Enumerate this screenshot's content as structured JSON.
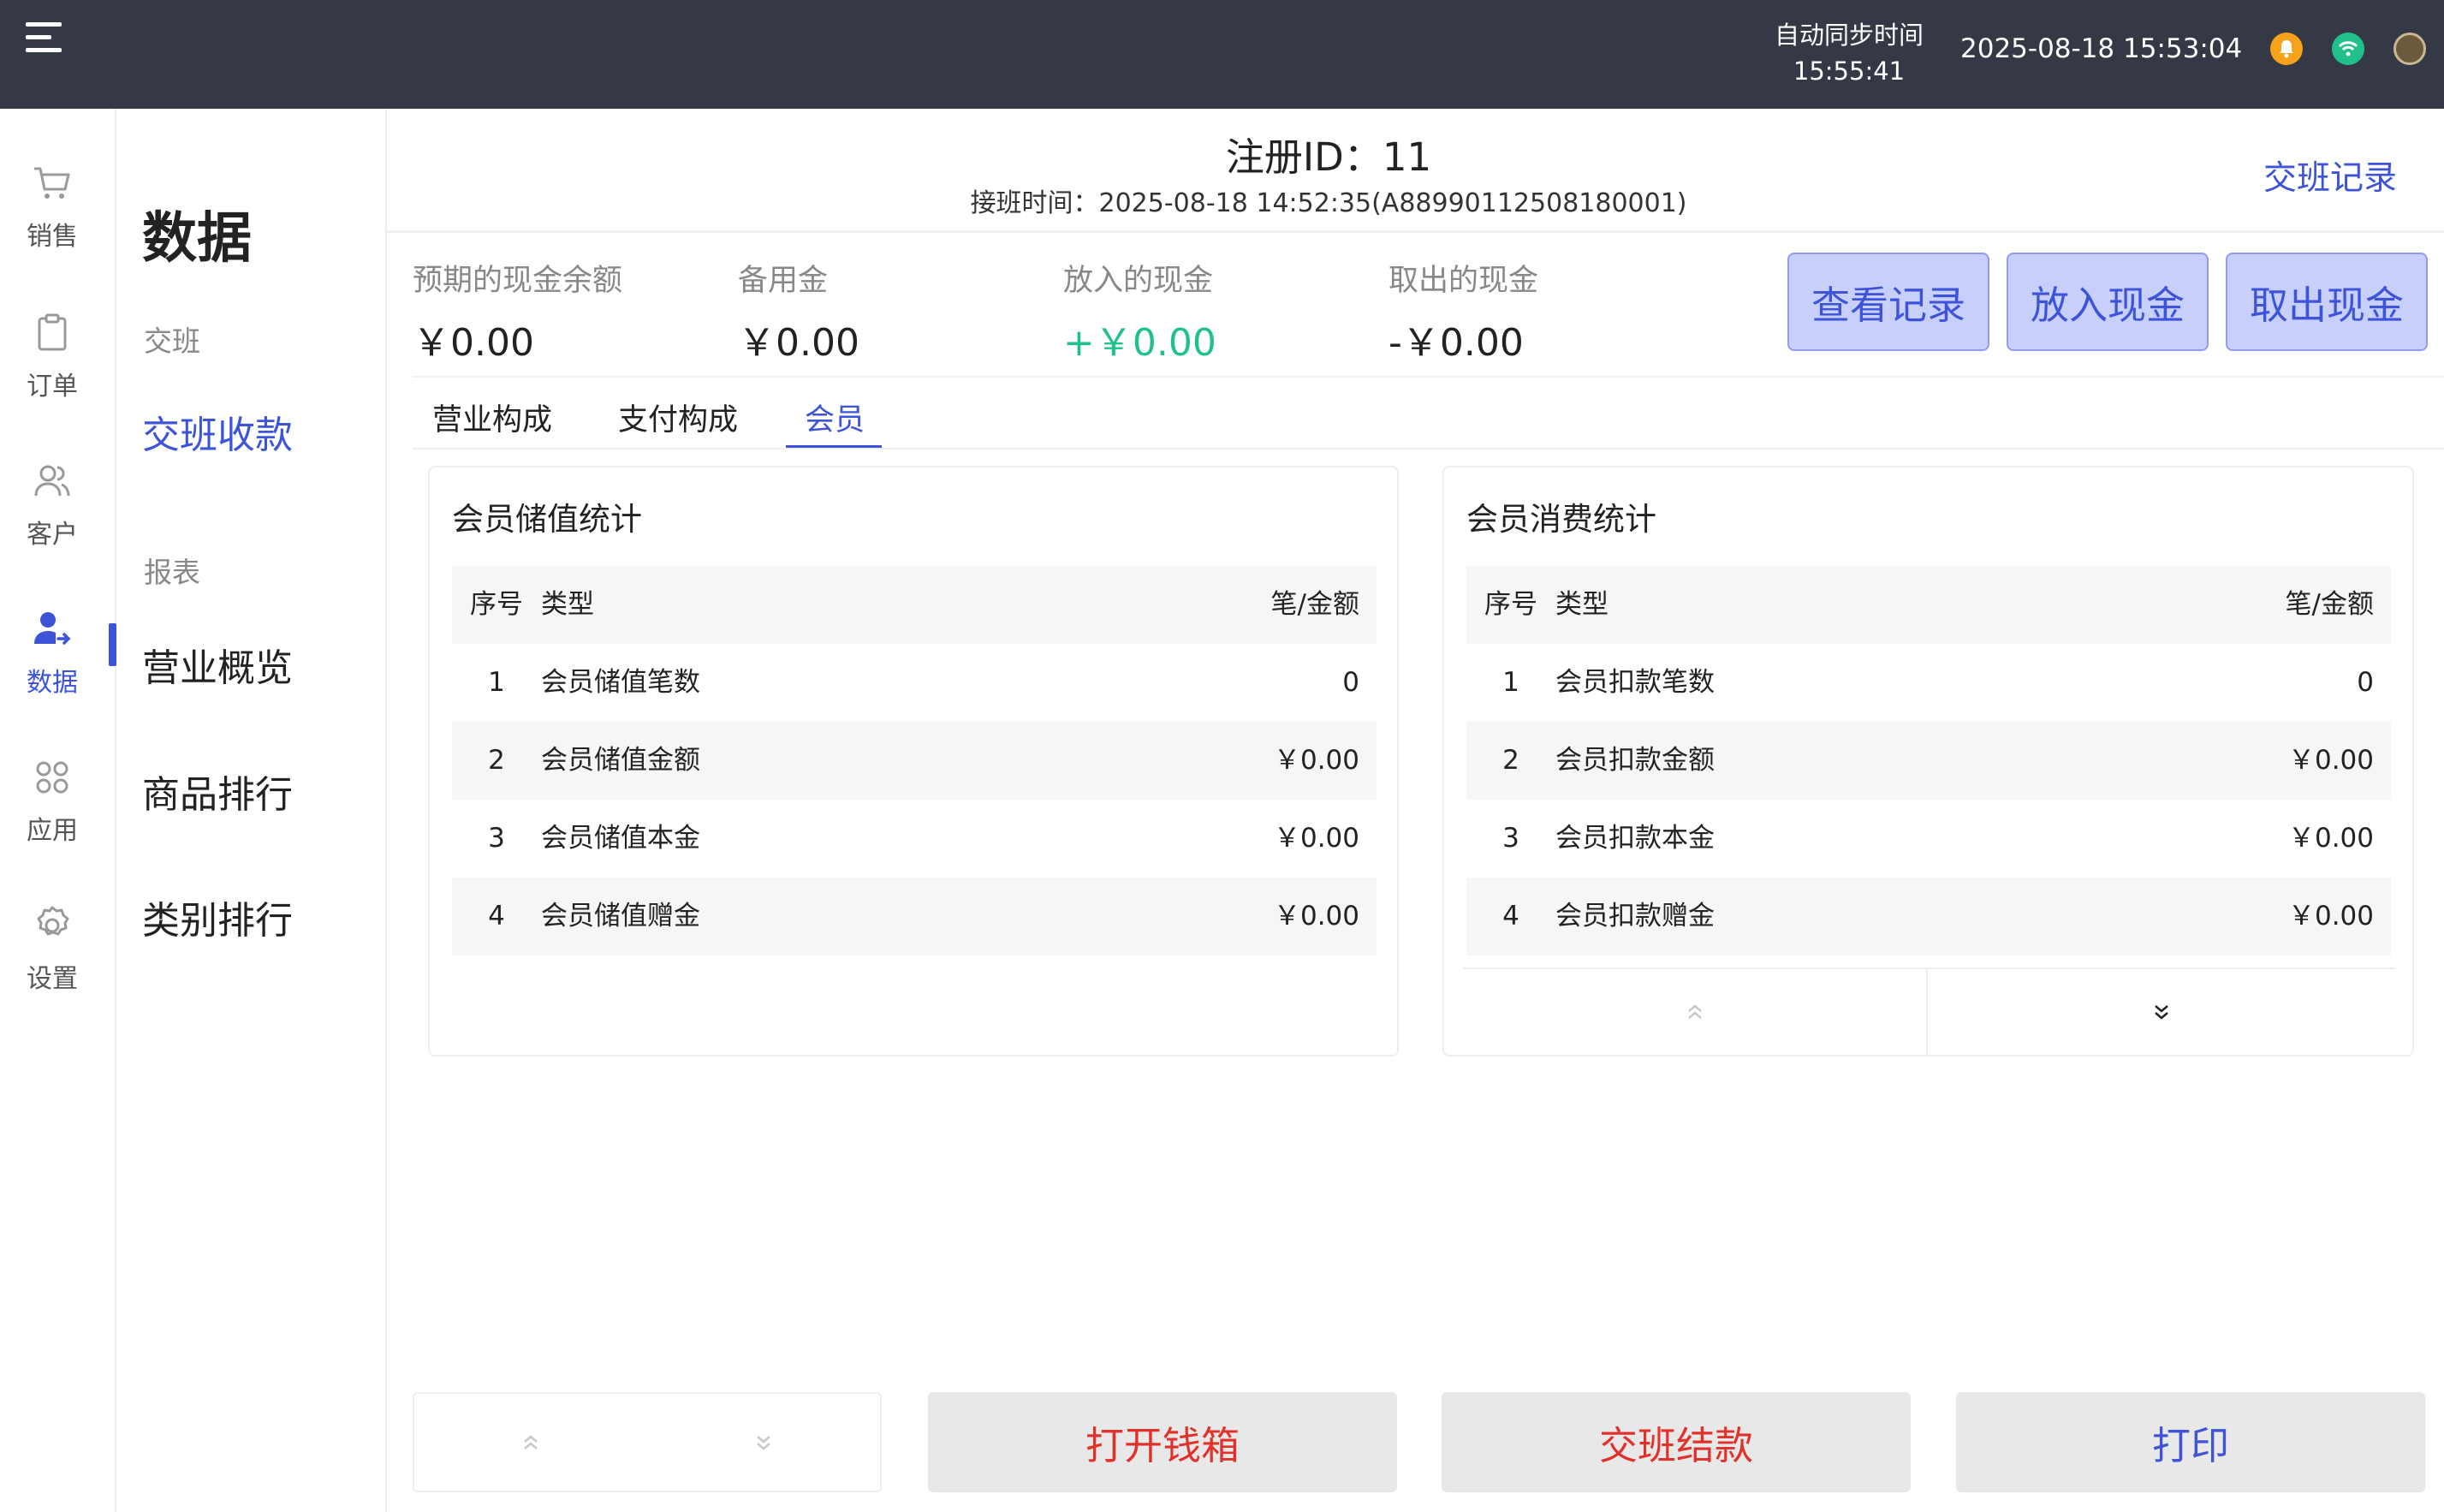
{
  "topbar": {
    "sync_label": "自动同步时间",
    "sync_time": "15:55:41",
    "datetime": "2025-08-18 15:53:04"
  },
  "rail": {
    "items": [
      {
        "label": "销售",
        "icon": "cart-icon"
      },
      {
        "label": "订单",
        "icon": "clipboard-icon"
      },
      {
        "label": "客户",
        "icon": "users-icon"
      },
      {
        "label": "数据",
        "icon": "user-data-icon"
      },
      {
        "label": "应用",
        "icon": "apps-icon"
      },
      {
        "label": "设置",
        "icon": "gear-icon"
      }
    ],
    "active_index": 3
  },
  "subnav": {
    "title": "数据",
    "group_shift": "交班",
    "item_shift_payment": "交班收款",
    "group_reports": "报表",
    "item_overview": "营业概览",
    "item_product_rank": "商品排行",
    "item_category_rank": "类别排行"
  },
  "header": {
    "register_id": "注册ID：11",
    "shift_time": "接班时间：2025-08-18 14:52:35(A88990112508180001)",
    "shift_log": "交班记录"
  },
  "stats": [
    {
      "label": "预期的现金余额",
      "value": "￥0.00"
    },
    {
      "label": "备用金",
      "value": "￥0.00"
    },
    {
      "label": "放入的现金",
      "value": "+￥0.00"
    },
    {
      "label": "取出的现金",
      "value": "-￥0.00"
    }
  ],
  "actions": {
    "view_records": "查看记录",
    "cash_in": "放入现金",
    "cash_out": "取出现金"
  },
  "tabs": [
    {
      "label": "营业构成"
    },
    {
      "label": "支付构成"
    },
    {
      "label": "会员"
    }
  ],
  "active_tab": 2,
  "columns": {
    "no": "序号",
    "type": "类型",
    "amount": "笔/金额"
  },
  "stored_value": {
    "title": "会员储值统计",
    "rows": [
      {
        "no": "1",
        "type": "会员储值笔数",
        "value": "0"
      },
      {
        "no": "2",
        "type": "会员储值金额",
        "value": "￥0.00"
      },
      {
        "no": "3",
        "type": "会员储值本金",
        "value": "￥0.00"
      },
      {
        "no": "4",
        "type": "会员储值赠金",
        "value": "￥0.00"
      }
    ]
  },
  "consumption": {
    "title": "会员消费统计",
    "rows": [
      {
        "no": "1",
        "type": "会员扣款笔数",
        "value": "0"
      },
      {
        "no": "2",
        "type": "会员扣款金额",
        "value": "￥0.00"
      },
      {
        "no": "3",
        "type": "会员扣款本金",
        "value": "￥0.00"
      },
      {
        "no": "4",
        "type": "会员扣款赠金",
        "value": "￥0.00"
      }
    ]
  },
  "bottom": {
    "open_drawer": "打开钱箱",
    "settle_shift": "交班结款",
    "print": "打印"
  },
  "colors": {
    "accent": "#3d54d9",
    "green": "#20c28a",
    "red": "#e0322b",
    "topbar": "#353945"
  }
}
